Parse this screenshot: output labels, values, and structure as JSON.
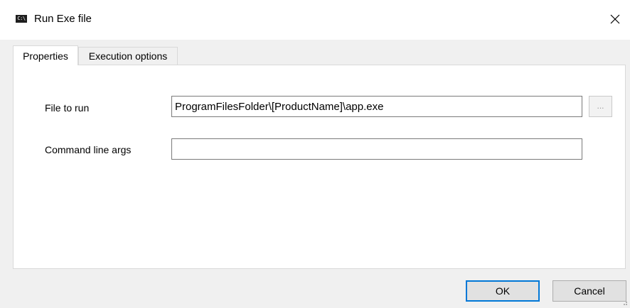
{
  "window": {
    "title": "Run Exe file",
    "icon_text": "C:\\"
  },
  "tabs": [
    {
      "label": "Properties",
      "selected": true
    },
    {
      "label": "Execution options",
      "selected": false
    }
  ],
  "form": {
    "file_to_run": {
      "label": "File to run",
      "value": "ProgramFilesFolder\\[ProductName]\\app.exe",
      "browse_label": "..."
    },
    "command_line_args": {
      "label": "Command line args",
      "value": ""
    }
  },
  "buttons": {
    "ok": "OK",
    "cancel": "Cancel"
  }
}
